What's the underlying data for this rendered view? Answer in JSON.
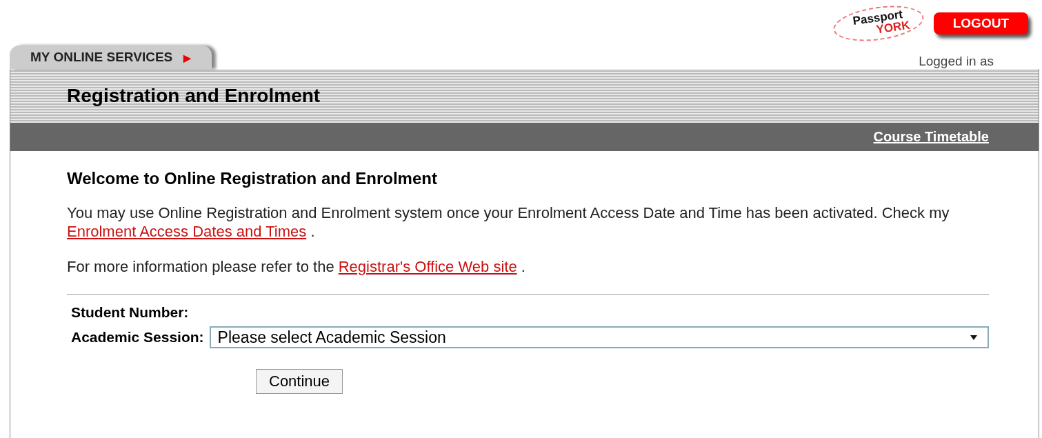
{
  "header": {
    "logo": {
      "line_1": "Passport",
      "line_2": "YORK"
    },
    "logout": "LOGOUT",
    "logged_in": "Logged in as"
  },
  "tab": {
    "label": "MY ONLINE SERVICES",
    "arrow": "▶"
  },
  "title": "Registration and Enrolment",
  "toolbar_link": "Course Timetable",
  "content": {
    "heading": "Welcome to Online Registration and Enrolment",
    "paragraphs": [
      {
        "before": "You may use Online Registration and Enrolment system once your Enrolment Access Date and Time has been activated. Check my",
        "link": "Enrolment Access Dates and Times",
        "after": "."
      },
      {
        "before": "For more information please refer to the",
        "link": "Registrar's Office Web site",
        "after": "."
      }
    ]
  },
  "form": {
    "student_number_label": "Student Number:",
    "session_label": "Academic Session:",
    "session_value": "Please select Academic Session",
    "continue": "Continue"
  }
}
